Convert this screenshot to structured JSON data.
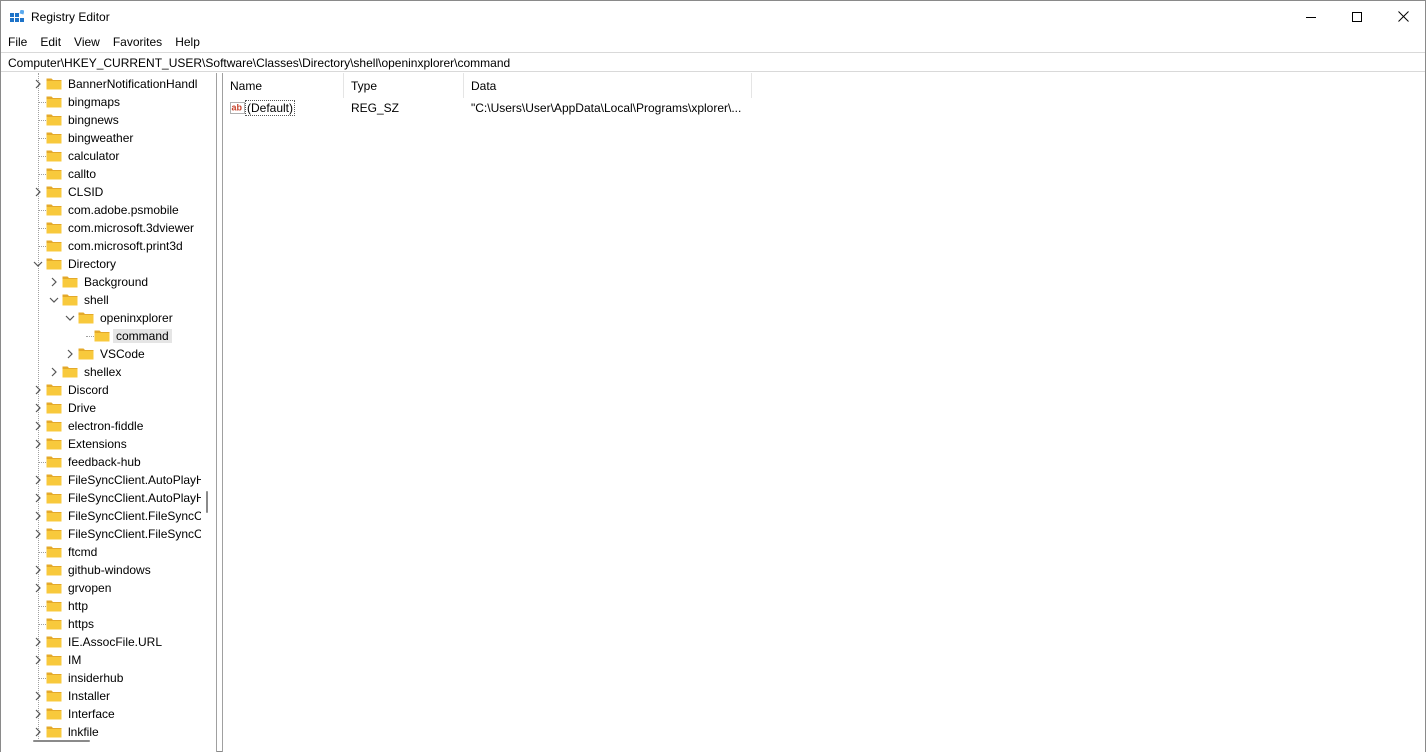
{
  "window": {
    "title": "Registry Editor",
    "icon": "registry-icon"
  },
  "menu": [
    "File",
    "Edit",
    "View",
    "Favorites",
    "Help"
  ],
  "address": "Computer\\HKEY_CURRENT_USER\\Software\\Classes\\Directory\\shell\\openinxplorer\\command",
  "tree": {
    "items": [
      {
        "label": "BannerNotificationHandl",
        "level": 0,
        "expander": "collapsed"
      },
      {
        "label": "bingmaps",
        "level": 0,
        "expander": "none"
      },
      {
        "label": "bingnews",
        "level": 0,
        "expander": "none"
      },
      {
        "label": "bingweather",
        "level": 0,
        "expander": "none"
      },
      {
        "label": "calculator",
        "level": 0,
        "expander": "none"
      },
      {
        "label": "callto",
        "level": 0,
        "expander": "none"
      },
      {
        "label": "CLSID",
        "level": 0,
        "expander": "collapsed"
      },
      {
        "label": "com.adobe.psmobile",
        "level": 0,
        "expander": "none"
      },
      {
        "label": "com.microsoft.3dviewer",
        "level": 0,
        "expander": "none"
      },
      {
        "label": "com.microsoft.print3d",
        "level": 0,
        "expander": "none"
      },
      {
        "label": "Directory",
        "level": 0,
        "expander": "expanded"
      },
      {
        "label": "Background",
        "level": 1,
        "expander": "collapsed"
      },
      {
        "label": "shell",
        "level": 1,
        "expander": "expanded"
      },
      {
        "label": "openinxplorer",
        "level": 2,
        "expander": "expanded"
      },
      {
        "label": "command",
        "level": 3,
        "expander": "none",
        "selected": true
      },
      {
        "label": "VSCode",
        "level": 2,
        "expander": "collapsed"
      },
      {
        "label": "shellex",
        "level": 1,
        "expander": "collapsed"
      },
      {
        "label": "Discord",
        "level": 0,
        "expander": "collapsed"
      },
      {
        "label": "Drive",
        "level": 0,
        "expander": "collapsed"
      },
      {
        "label": "electron-fiddle",
        "level": 0,
        "expander": "collapsed"
      },
      {
        "label": "Extensions",
        "level": 0,
        "expander": "collapsed"
      },
      {
        "label": "feedback-hub",
        "level": 0,
        "expander": "none"
      },
      {
        "label": "FileSyncClient.AutoPlayH",
        "level": 0,
        "expander": "collapsed"
      },
      {
        "label": "FileSyncClient.AutoPlayH",
        "level": 0,
        "expander": "collapsed"
      },
      {
        "label": "FileSyncClient.FileSyncCl",
        "level": 0,
        "expander": "collapsed"
      },
      {
        "label": "FileSyncClient.FileSyncCl",
        "level": 0,
        "expander": "collapsed"
      },
      {
        "label": "ftcmd",
        "level": 0,
        "expander": "none"
      },
      {
        "label": "github-windows",
        "level": 0,
        "expander": "collapsed"
      },
      {
        "label": "grvopen",
        "level": 0,
        "expander": "collapsed"
      },
      {
        "label": "http",
        "level": 0,
        "expander": "none"
      },
      {
        "label": "https",
        "level": 0,
        "expander": "none"
      },
      {
        "label": "IE.AssocFile.URL",
        "level": 0,
        "expander": "collapsed"
      },
      {
        "label": "IM",
        "level": 0,
        "expander": "collapsed"
      },
      {
        "label": "insiderhub",
        "level": 0,
        "expander": "none"
      },
      {
        "label": "Installer",
        "level": 0,
        "expander": "collapsed"
      },
      {
        "label": "Interface",
        "level": 0,
        "expander": "collapsed"
      },
      {
        "label": "lnkfile",
        "level": 0,
        "expander": "collapsed"
      }
    ]
  },
  "list": {
    "columns": [
      "Name",
      "Type",
      "Data"
    ],
    "rows": [
      {
        "name": "(Default)",
        "type": "REG_SZ",
        "data": "\"C:\\Users\\User\\AppData\\Local\\Programs\\xplorer\\...",
        "icon": "string-value-icon"
      }
    ]
  },
  "colors": {
    "folder": "#f8c93c",
    "folder_dark": "#e4a92a",
    "selection": "#e5e5e5",
    "value_icon": "#c8432b"
  }
}
